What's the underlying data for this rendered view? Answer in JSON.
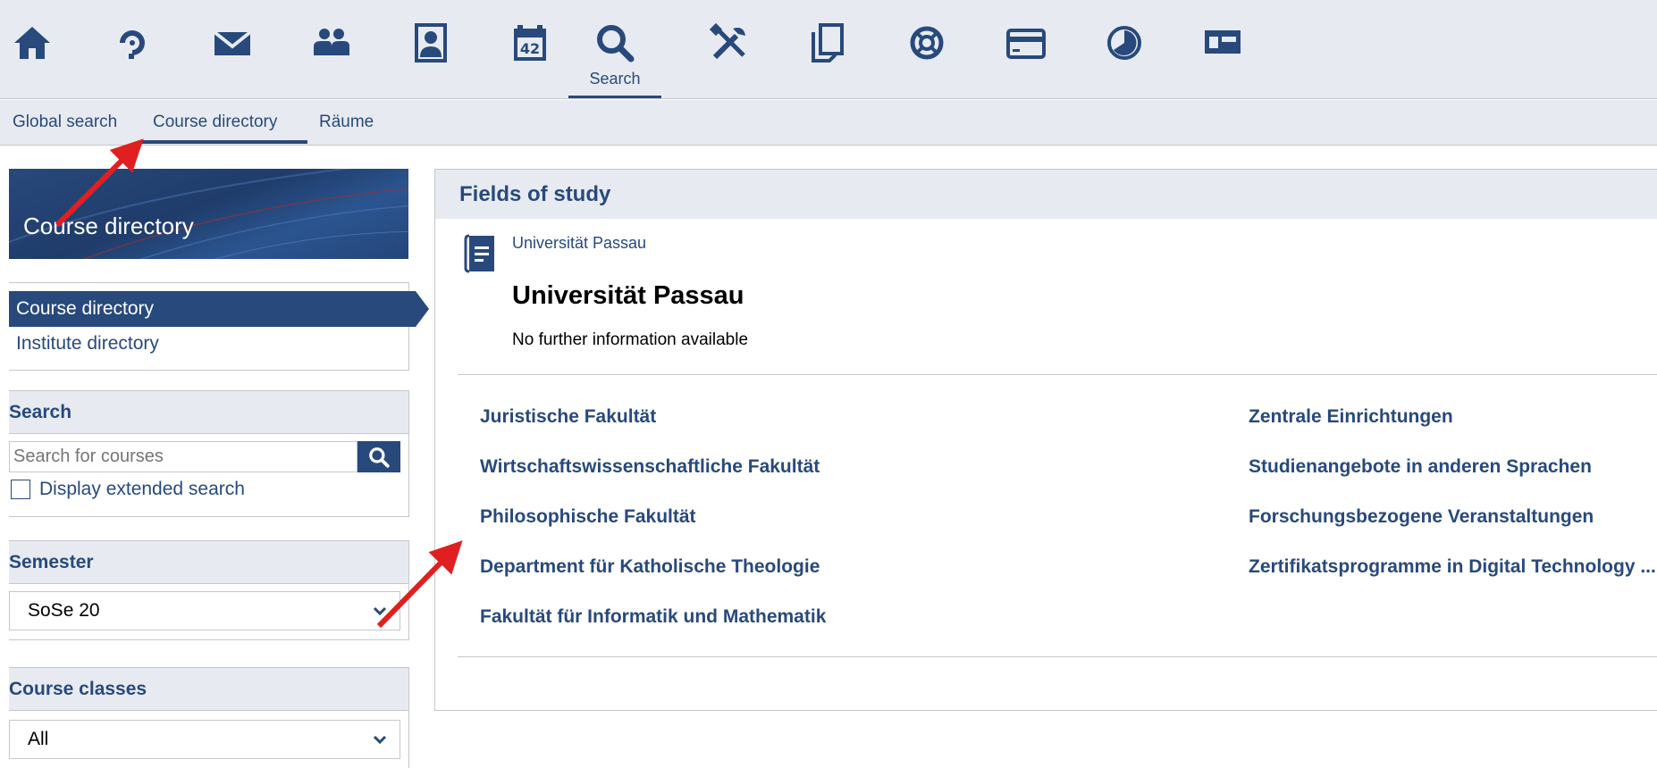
{
  "topnav": {
    "icons": [
      {
        "name": "home-icon"
      },
      {
        "name": "activity-icon"
      },
      {
        "name": "mail-icon"
      },
      {
        "name": "community-icon"
      },
      {
        "name": "profile-icon"
      },
      {
        "name": "calendar-icon",
        "text": "42"
      },
      {
        "name": "search-icon",
        "label": "Search",
        "active": true
      },
      {
        "name": "tools-icon"
      },
      {
        "name": "files-icon"
      },
      {
        "name": "help-icon"
      },
      {
        "name": "card-icon"
      },
      {
        "name": "stats-icon"
      },
      {
        "name": "dashboard-icon"
      }
    ]
  },
  "subnav": {
    "items": [
      {
        "label": "Global search"
      },
      {
        "label": "Course directory",
        "active": true
      },
      {
        "label": "Räume"
      }
    ]
  },
  "sidebar": {
    "header_title": "Course directory",
    "nav": [
      {
        "label": "Course directory",
        "active": true
      },
      {
        "label": "Institute directory"
      }
    ],
    "search": {
      "title": "Search",
      "placeholder": "Search for courses",
      "checkbox_label": "Display extended search"
    },
    "semester": {
      "title": "Semester",
      "selected": "SoSe 20"
    },
    "course_classes": {
      "title": "Course classes",
      "selected": "All"
    }
  },
  "main": {
    "header": "Fields of study",
    "breadcrumb": "Universität Passau",
    "title": "Universität Passau",
    "info": "No further information available",
    "faculties_left": [
      "Juristische Fakultät",
      "Wirtschaftswissenschaftliche Fakultät",
      "Philosophische Fakultät",
      "Department für Katholische Theologie",
      "Fakultät für Informatik und Mathematik"
    ],
    "faculties_right": [
      "Zentrale Einrichtungen",
      "Studienangebote in anderen Sprachen",
      "Forschungsbezogene Veranstaltungen",
      "Zertifikatsprogramme in Digital Technology ..."
    ]
  },
  "colors": {
    "primary": "#28497c",
    "bar_bg": "#e7ebf1",
    "border": "#c5c7ca",
    "annotation": "#e02020"
  }
}
